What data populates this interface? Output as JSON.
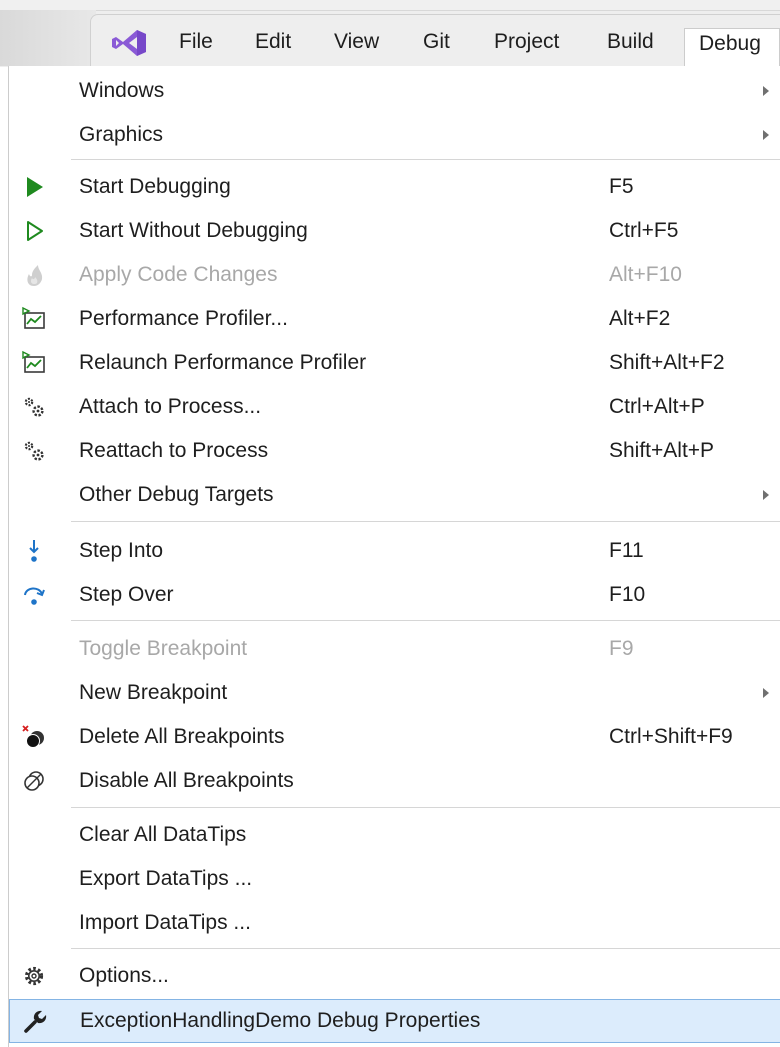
{
  "menubar": {
    "items": [
      {
        "label": "File"
      },
      {
        "label": "Edit"
      },
      {
        "label": "View"
      },
      {
        "label": "Git"
      },
      {
        "label": "Project"
      },
      {
        "label": "Build"
      },
      {
        "label": "Debug"
      }
    ]
  },
  "debug_menu": {
    "items": [
      {
        "label": "Windows",
        "submenu": true
      },
      {
        "label": "Graphics",
        "submenu": true
      },
      {
        "label": "Start Debugging",
        "shortcut": "F5",
        "icon": "play-filled-icon"
      },
      {
        "label": "Start Without Debugging",
        "shortcut": "Ctrl+F5",
        "icon": "play-outline-icon"
      },
      {
        "label": "Apply Code Changes",
        "shortcut": "Alt+F10",
        "icon": "flame-icon",
        "disabled": true
      },
      {
        "label": "Performance Profiler...",
        "shortcut": "Alt+F2",
        "icon": "performance-profiler-icon"
      },
      {
        "label": "Relaunch Performance Profiler",
        "shortcut": "Shift+Alt+F2",
        "icon": "performance-profiler-icon"
      },
      {
        "label": "Attach to Process...",
        "shortcut": "Ctrl+Alt+P",
        "icon": "gears-icon"
      },
      {
        "label": "Reattach to Process",
        "shortcut": "Shift+Alt+P",
        "icon": "gears-icon"
      },
      {
        "label": "Other Debug Targets",
        "submenu": true
      },
      {
        "label": "Step Into",
        "shortcut": "F11",
        "icon": "step-into-icon"
      },
      {
        "label": "Step Over",
        "shortcut": "F10",
        "icon": "step-over-icon"
      },
      {
        "label": "Toggle Breakpoint",
        "shortcut": "F9",
        "disabled": true
      },
      {
        "label": "New Breakpoint",
        "submenu": true
      },
      {
        "label": "Delete All Breakpoints",
        "shortcut": "Ctrl+Shift+F9",
        "icon": "delete-breakpoints-icon"
      },
      {
        "label": "Disable All Breakpoints",
        "icon": "disable-breakpoints-icon"
      },
      {
        "label": "Clear All DataTips"
      },
      {
        "label": "Export DataTips ..."
      },
      {
        "label": "Import DataTips ..."
      },
      {
        "label": "Options...",
        "icon": "gear-icon"
      },
      {
        "label": "ExceptionHandlingDemo Debug Properties",
        "icon": "wrench-icon",
        "highlighted": true
      }
    ]
  },
  "colors": {
    "accent_green": "#1f8a1f",
    "accent_blue": "#1e74c8",
    "highlight_bg": "#dcecfc",
    "highlight_border": "#84b4e4",
    "vs_purple": "#8a5ad6"
  }
}
